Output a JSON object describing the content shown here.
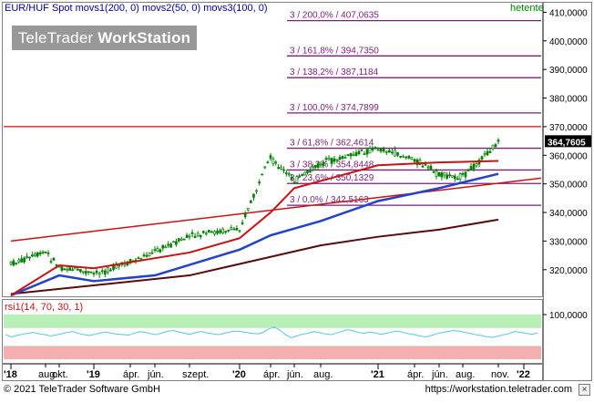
{
  "header": {
    "title": "EUR/HUF Spot movs1(200, 0) movs2(50, 0) movs3(100, 0)",
    "period": "hetente"
  },
  "watermark": {
    "brand_light": "TeleTrader ",
    "brand_bold": "WorkStation"
  },
  "footer": {
    "copyright": "© 2021 TeleTrader Software GmbH",
    "website": "https://workstation.teletrader.com"
  },
  "colors": {
    "price_candles": "#008000",
    "movs1": "#5a0a0a",
    "movs2": "#2244cc",
    "movs3": "#cc1111",
    "fibonacci": "#7b1f7b",
    "trendline": "#cc1111",
    "rsi_line": "#4ec8e6",
    "rsi_overbought_zone": "#b8f0b8",
    "rsi_oversold_zone": "#f4b0b0"
  },
  "chart_data": [
    {
      "type": "candlestick",
      "title": "EUR/HUF Spot",
      "series": [
        {
          "name": "movs1(200, 0)"
        },
        {
          "name": "movs2(50, 0)"
        },
        {
          "name": "movs3(100, 0)"
        }
      ],
      "ylim": [
        311000,
        413000
      ],
      "y_ticks": [
        "410,0000",
        "400,0000",
        "390,0000",
        "380,0000",
        "370,0000",
        "360,0000",
        "350,0000",
        "340,0000",
        "330,0000",
        "320,0000"
      ],
      "last_value_label": "364,7605",
      "x_tick_labels": [
        "'18",
        "aug.",
        "okt.",
        "'19",
        "ápr.",
        "jún.",
        "szept.",
        "'20",
        "ápr.",
        "jún.",
        "aug.",
        "'21",
        "ápr.",
        "jún.",
        "aug.",
        "nov.",
        "'22"
      ],
      "fibonacci_levels": [
        {
          "label": "3 / 200,0% / 407,0635",
          "value": 407063.5
        },
        {
          "label": "3 / 161,8% / 394,7350",
          "value": 394735.0
        },
        {
          "label": "3 / 138,2% / 387,1184",
          "value": 387118.4
        },
        {
          "label": "3 / 100,0% / 374,7899",
          "value": 374789.9
        },
        {
          "label": "3 / 61,8% / 362,4614",
          "value": 362461.4
        },
        {
          "label": "3 / 38,2% / 354,8448",
          "value": 354844.8
        },
        {
          "label": "3 / 23,6% / 350,1329",
          "value": 350132.9
        },
        {
          "label": "3 / 0,0% / 342,5163",
          "value": 342516.3
        }
      ],
      "horizontal_line": {
        "value": 370000
      },
      "trend_line": {
        "from_x": "'18",
        "from_value": 330000,
        "to_x": "'22",
        "to_value": 352000
      },
      "price_path": [
        {
          "x": "'18",
          "value": 322000
        },
        {
          "x": "aug.",
          "value": 326000
        },
        {
          "x": "okt.",
          "value": 321000
        },
        {
          "x": "'19",
          "value": 318500
        },
        {
          "x": "ápr.",
          "value": 322500
        },
        {
          "x": "jún.",
          "value": 326500
        },
        {
          "x": "szept.",
          "value": 331500
        },
        {
          "x": "'20",
          "value": 334500
        },
        {
          "x": "ápr.",
          "value": 359000
        },
        {
          "x": "jún.",
          "value": 351000
        },
        {
          "x": "aug.",
          "value": 357000
        },
        {
          "x": "'21",
          "value": 362500
        },
        {
          "x": "ápr.",
          "value": 358500
        },
        {
          "x": "jún.",
          "value": 353000
        },
        {
          "x": "aug.",
          "value": 352500
        },
        {
          "x": "nov.",
          "value": 364760
        }
      ],
      "movs1_path": [
        {
          "x": "'18",
          "value": 311500
        },
        {
          "x": "szept.",
          "value": 318000
        },
        {
          "x": "'20",
          "value": 322000
        },
        {
          "x": "aug.",
          "value": 328500
        },
        {
          "x": "'21",
          "value": 331500
        },
        {
          "x": "jún.",
          "value": 334000
        },
        {
          "x": "nov.",
          "value": 337500
        }
      ],
      "movs2_path": [
        {
          "x": "'18",
          "value": 311000
        },
        {
          "x": "okt.",
          "value": 318000
        },
        {
          "x": "'19",
          "value": 316000
        },
        {
          "x": "jún.",
          "value": 318000
        },
        {
          "x": "'20",
          "value": 327000
        },
        {
          "x": "ápr.",
          "value": 332000
        },
        {
          "x": "aug.",
          "value": 337000
        },
        {
          "x": "'21",
          "value": 344000
        },
        {
          "x": "jún.",
          "value": 348500
        },
        {
          "x": "nov.",
          "value": 353500
        }
      ],
      "movs3_path": [
        {
          "x": "'18",
          "value": 311000
        },
        {
          "x": "okt.",
          "value": 321500
        },
        {
          "x": "'19",
          "value": 320500
        },
        {
          "x": "szept.",
          "value": 326000
        },
        {
          "x": "'20",
          "value": 331000
        },
        {
          "x": "ápr.",
          "value": 340000
        },
        {
          "x": "jún.",
          "value": 348500
        },
        {
          "x": "'21",
          "value": 356500
        },
        {
          "x": "jún.",
          "value": 357500
        },
        {
          "x": "nov.",
          "value": 358000
        }
      ]
    },
    {
      "type": "line",
      "title": "rsi1(14, 70, 30, 1)",
      "ylim": [
        0,
        100
      ],
      "y_ticks": [
        "100,0000"
      ],
      "overbought": 70,
      "oversold": 30,
      "series": [
        {
          "name": "rsi1(14, 70, 30, 1)",
          "values": [
            55,
            50,
            53,
            56,
            58,
            60,
            57,
            55,
            52,
            54,
            57,
            60,
            62,
            58,
            55,
            53,
            56,
            59,
            61,
            58,
            56,
            55,
            54,
            58,
            62,
            60,
            57,
            55,
            59,
            63,
            64,
            61,
            58,
            56,
            60,
            62,
            59,
            57,
            55,
            58,
            61,
            63,
            62,
            60,
            58,
            57,
            60,
            68,
            72,
            65,
            55,
            48,
            52,
            56,
            58,
            62,
            60,
            57,
            55,
            58,
            62,
            66,
            64,
            60,
            58,
            61,
            59,
            56,
            58,
            61,
            63,
            60,
            57,
            55,
            52,
            50,
            53,
            57,
            60,
            62,
            64,
            63,
            60,
            58,
            55,
            53,
            50,
            49,
            52,
            55,
            58,
            62,
            60,
            58,
            56,
            59
          ]
        }
      ]
    }
  ]
}
